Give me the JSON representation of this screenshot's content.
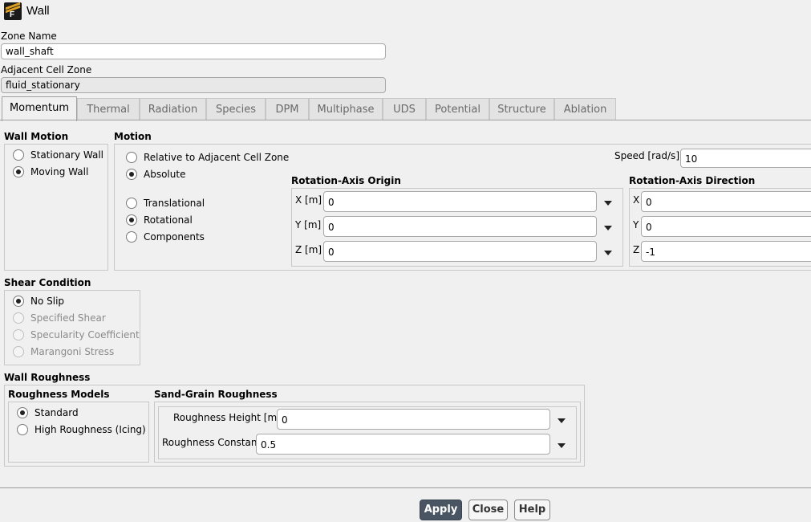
{
  "window": {
    "title": "Wall",
    "icon": "fluent-logo-icon"
  },
  "zone_name": {
    "label": "Zone Name",
    "value": "wall_shaft"
  },
  "adjacent_cell_zone": {
    "label": "Adjacent Cell Zone",
    "value": "fluid_stationary"
  },
  "tabs": [
    {
      "label": "Momentum",
      "active": true
    },
    {
      "label": "Thermal"
    },
    {
      "label": "Radiation"
    },
    {
      "label": "Species"
    },
    {
      "label": "DPM"
    },
    {
      "label": "Multiphase"
    },
    {
      "label": "UDS"
    },
    {
      "label": "Potential"
    },
    {
      "label": "Structure"
    },
    {
      "label": "Ablation"
    }
  ],
  "wall_motion": {
    "title": "Wall Motion",
    "options": [
      {
        "label": "Stationary Wall",
        "selected": false
      },
      {
        "label": "Moving Wall",
        "selected": true
      }
    ]
  },
  "motion": {
    "title": "Motion",
    "reference": [
      {
        "label": "Relative to Adjacent Cell Zone",
        "selected": false
      },
      {
        "label": "Absolute",
        "selected": true
      }
    ],
    "type": [
      {
        "label": "Translational",
        "selected": false
      },
      {
        "label": "Rotational",
        "selected": true
      },
      {
        "label": "Components",
        "selected": false
      }
    ],
    "speed": {
      "label": "Speed [rad/s]",
      "value": "10"
    },
    "origin": {
      "title": "Rotation-Axis Origin",
      "x": {
        "label": "X [m]",
        "value": "0"
      },
      "y": {
        "label": "Y [m]",
        "value": "0"
      },
      "z": {
        "label": "Z [m]",
        "value": "0"
      }
    },
    "direction": {
      "title": "Rotation-Axis Direction",
      "x": {
        "label": "X",
        "value": "0"
      },
      "y": {
        "label": "Y",
        "value": "0"
      },
      "z": {
        "label": "Z",
        "value": "-1"
      }
    }
  },
  "shear_condition": {
    "title": "Shear Condition",
    "options": [
      {
        "label": "No Slip",
        "selected": true,
        "enabled": true
      },
      {
        "label": "Specified Shear",
        "selected": false,
        "enabled": false
      },
      {
        "label": "Specularity Coefficient",
        "selected": false,
        "enabled": false
      },
      {
        "label": "Marangoni Stress",
        "selected": false,
        "enabled": false
      }
    ]
  },
  "wall_roughness": {
    "title": "Wall Roughness",
    "models": {
      "title": "Roughness Models",
      "options": [
        {
          "label": "Standard",
          "selected": true
        },
        {
          "label": "High Roughness (Icing)",
          "selected": false
        }
      ]
    },
    "sand_grain": {
      "title": "Sand-Grain Roughness",
      "height": {
        "label": "Roughness Height [m]",
        "value": "0"
      },
      "constant": {
        "label": "Roughness Constant",
        "value": "0.5"
      }
    }
  },
  "buttons": {
    "apply": "Apply",
    "close": "Close",
    "help": "Help"
  }
}
